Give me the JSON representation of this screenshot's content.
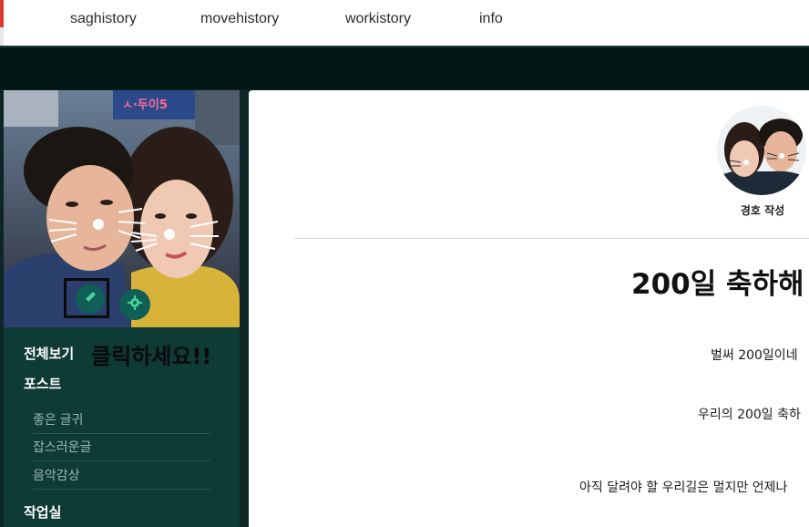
{
  "nav": {
    "items": [
      "saghistory",
      "movehistory",
      "workistory",
      "info"
    ]
  },
  "sidebar": {
    "annotation": "클릭하세요!!",
    "menu": {
      "all": "전체보기",
      "posts": "포스트",
      "post_items": [
        "좋은 글귀",
        "잡스러운글",
        "음악감상"
      ],
      "workshop": "작업실"
    },
    "photo_sign": "ㅅ·두이5",
    "icons": [
      "pencil-icon",
      "gear-icon"
    ]
  },
  "post": {
    "author": "경호 작성",
    "title": "200일 축하해",
    "paragraphs": [
      "벌써 200일이네",
      "우리의 200일 축하",
      "아직 달려야 할 우리길은 멀지만 언제나"
    ]
  },
  "colors": {
    "header_bg": "#ffffff",
    "band": "#021716",
    "sidebar_bg": "#0f3b37",
    "accent_button": "#0f5f57",
    "text_dark": "#111111"
  }
}
